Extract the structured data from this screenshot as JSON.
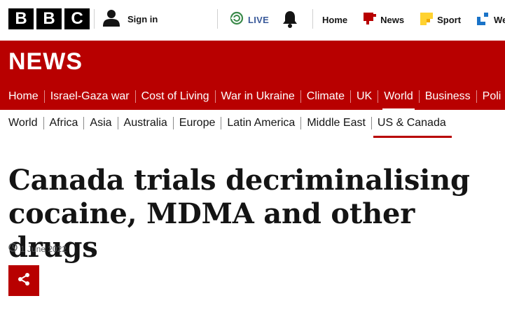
{
  "brand": {
    "logo_letters": [
      "B",
      "B",
      "C"
    ],
    "accent_color": "#b80000"
  },
  "topbar": {
    "signin_label": "Sign in",
    "live_label": "LIVE",
    "nav": [
      {
        "label": "Home",
        "icon": "none"
      },
      {
        "label": "News",
        "icon": "news-icon"
      },
      {
        "label": "Sport",
        "icon": "sport-icon"
      },
      {
        "label": "We",
        "icon": "weather-icon"
      }
    ]
  },
  "banner": {
    "title": "NEWS"
  },
  "primary_nav": {
    "items": [
      "Home",
      "Israel-Gaza war",
      "Cost of Living",
      "War in Ukraine",
      "Climate",
      "UK",
      "World",
      "Business",
      "Poli"
    ],
    "active": "World"
  },
  "secondary_nav": {
    "items": [
      "World",
      "Africa",
      "Asia",
      "Australia",
      "Europe",
      "Latin America",
      "Middle East",
      "US & Canada"
    ],
    "active": "US & Canada"
  },
  "article": {
    "headline": "Canada trials decriminalising cocaine, MDMA and other drugs",
    "date": "1 June 2022"
  }
}
